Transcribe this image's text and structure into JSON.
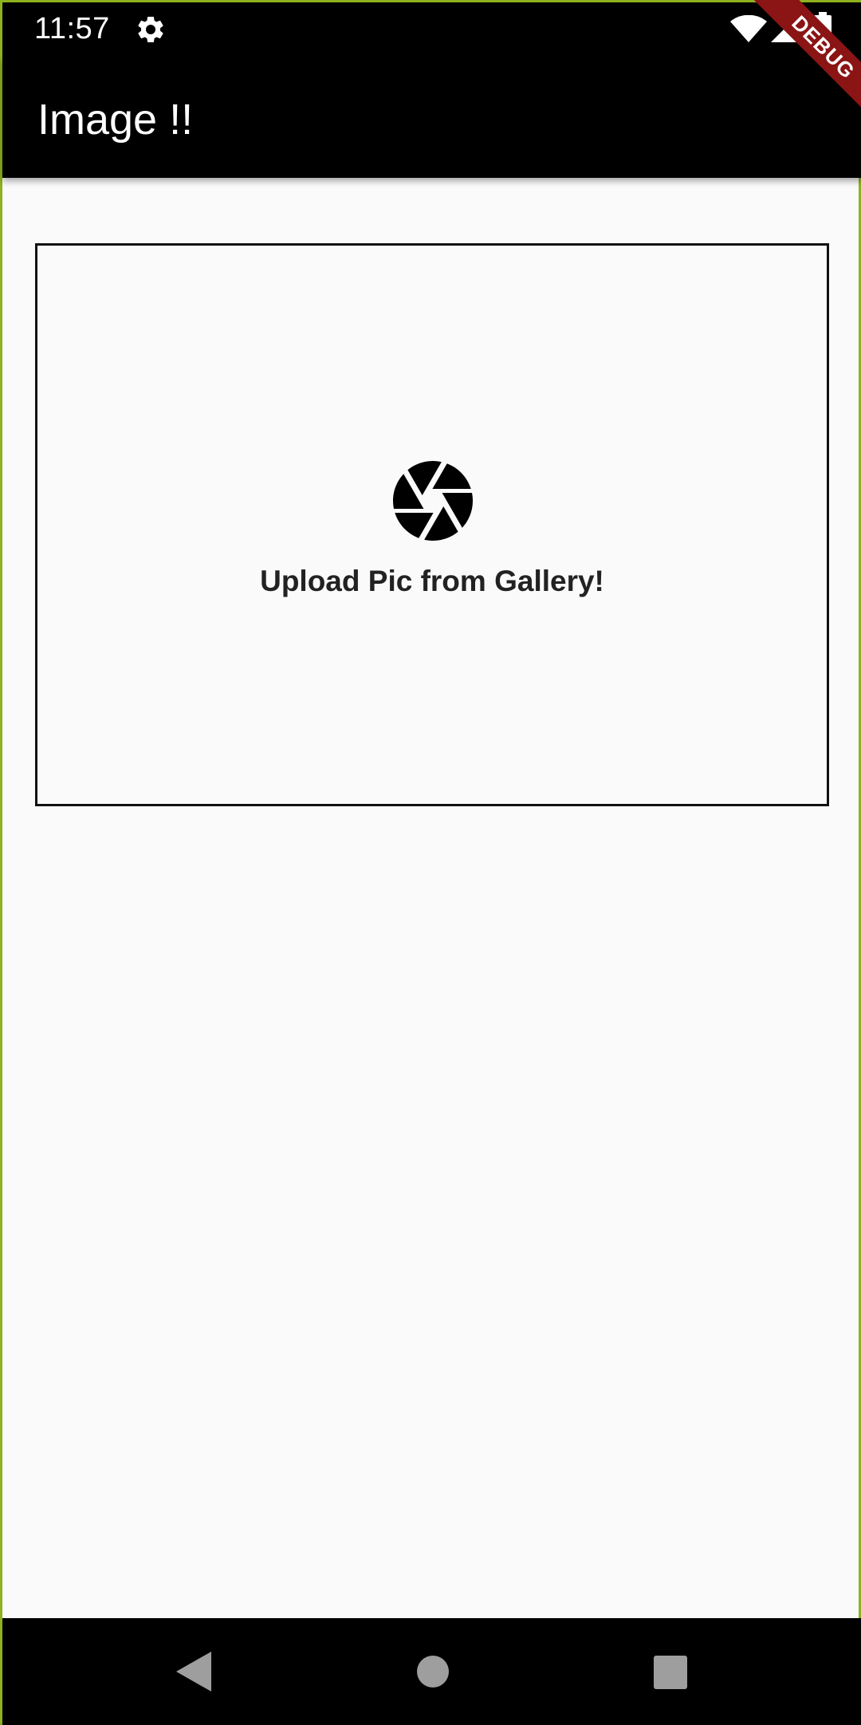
{
  "status_bar": {
    "time": "11:57",
    "icons": [
      "gear-icon",
      "wifi-icon",
      "signal-icon",
      "battery-icon"
    ]
  },
  "app_bar": {
    "title": "Image !!"
  },
  "debug_banner": {
    "label": "DEBUG",
    "color": "#8b1414"
  },
  "upload": {
    "icon": "camera-icon",
    "label": "Upload Pic from Gallery!"
  },
  "nav_bar": {
    "buttons": [
      "back-icon",
      "home-icon",
      "recents-icon"
    ]
  },
  "colors": {
    "app_bar": "#000000",
    "background": "#fafafa",
    "frame_accent": "#8fb21e"
  }
}
